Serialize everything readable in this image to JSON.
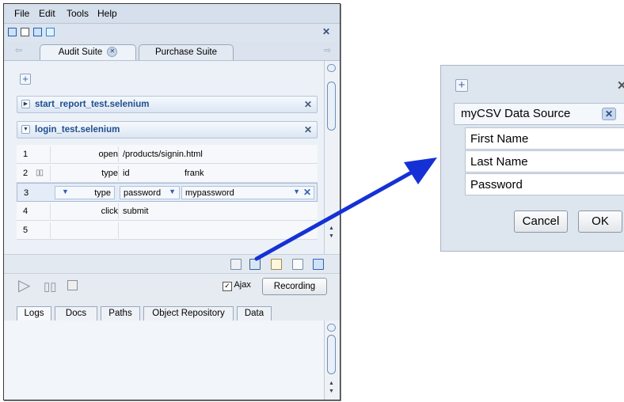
{
  "menu": [
    "File",
    "Edit",
    "Tools",
    "Help"
  ],
  "tabs": [
    {
      "label": "Audit Suite"
    },
    {
      "label": "Purchase Suite"
    }
  ],
  "scripts": [
    {
      "name": "start_report_test.selenium",
      "expanded": false
    },
    {
      "name": "login_test.selenium",
      "expanded": true
    }
  ],
  "steps": [
    {
      "num": "1",
      "command": "open",
      "target": "/products/signin.html",
      "value": ""
    },
    {
      "num": "2",
      "command": "type",
      "target": "id",
      "value": "frank"
    },
    {
      "num": "3",
      "command": "type",
      "target": "password",
      "value": "mypassword"
    },
    {
      "num": "4",
      "command": "click",
      "target": "submit",
      "value": ""
    },
    {
      "num": "5",
      "command": "",
      "target": "",
      "value": ""
    }
  ],
  "controls": {
    "ajax_label": "Ajax",
    "ajax_checked": true,
    "recording_label": "Recording"
  },
  "bottom_tabs": [
    "Logs",
    "Docs",
    "Paths",
    "Object Repository",
    "Data"
  ],
  "dialog": {
    "data_source": "myCSV Data Source",
    "fields": [
      "First Name",
      "Last Name",
      "Password"
    ],
    "cancel_label": "Cancel",
    "ok_label": "OK"
  },
  "colors": {
    "arrow": "#1531d6",
    "script_title": "#1f4f8e"
  },
  "icons": [
    "close-icon",
    "add-icon",
    "expand-triangle-icon",
    "play-icon",
    "pause-icon",
    "stop-icon",
    "dropdown-icon",
    "drag-handle-icon"
  ]
}
